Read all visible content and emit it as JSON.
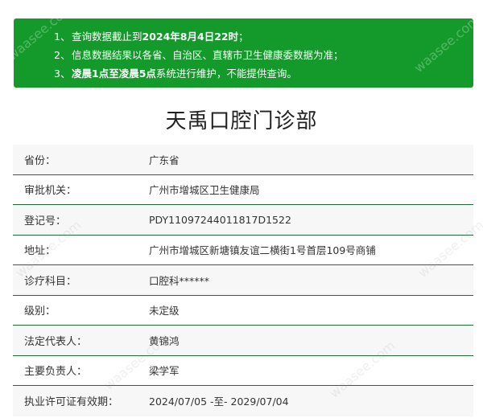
{
  "notice": {
    "lines": [
      {
        "num": "1、",
        "pre": "查询数据截止到",
        "bold": "2024年8月4日22时",
        "post": "；"
      },
      {
        "num": "2、",
        "pre": "信息数据结果以各省、自治区、直辖市卫生健康委数据为准；",
        "bold": "",
        "post": ""
      },
      {
        "num": "3、",
        "pre": "",
        "bold": "凌晨1点至凌晨5点",
        "post": "系统进行维护，不能提供查询。"
      }
    ]
  },
  "title": "天禹口腔门诊部",
  "rows": [
    {
      "label": "省份：",
      "value": "广东省"
    },
    {
      "label": "审批机关：",
      "value": "广州市增城区卫生健康局"
    },
    {
      "label": "登记号：",
      "value": "PDY11097244011817D1522"
    },
    {
      "label": "地址：",
      "value": "广州市增城区新塘镇友谊二横街1号首层109号商铺"
    },
    {
      "label": "诊疗科目：",
      "value": "口腔科******"
    },
    {
      "label": "级别：",
      "value": "未定级"
    },
    {
      "label": "法定代表人：",
      "value": "黄锦鸿"
    },
    {
      "label": "主要负责人：",
      "value": "梁学军"
    },
    {
      "label": "执业许可证有效期：",
      "value": "2024/07/05 -至- 2029/07/04"
    }
  ],
  "watermark": "waasee.com"
}
